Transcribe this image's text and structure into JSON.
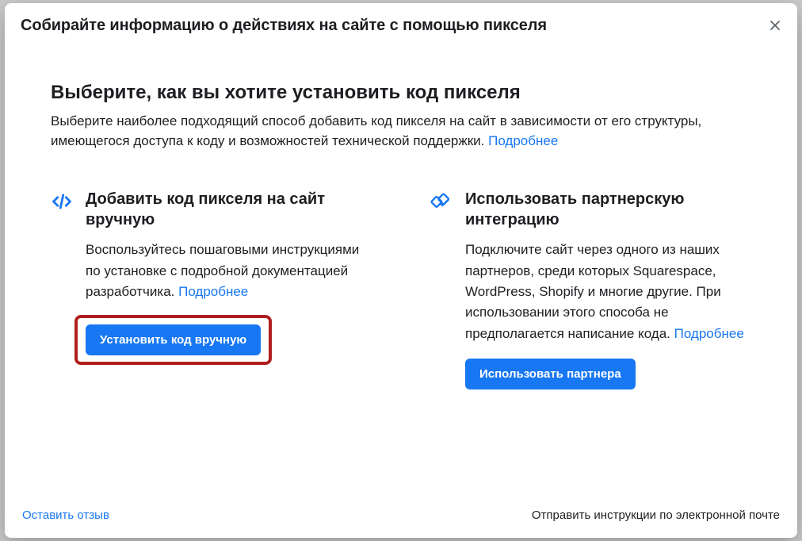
{
  "modal": {
    "title": "Собирайте информацию о действиях на сайте с помощью пикселя",
    "heading": "Выберите, как вы хотите установить код пикселя",
    "subtext": "Выберите наиболее подходящий способ добавить код пикселя на сайт в зависимости от его структуры, имеющегося доступа к коду и возможностей технической поддержки. ",
    "learn_more": "Подробнее"
  },
  "options": {
    "manual": {
      "title": "Добавить код пикселя на сайт вручную",
      "desc": "Воспользуйтесь пошаговыми инструкциями по установке с подробной документацией разработчика. ",
      "learn_more": "Подробнее",
      "button": "Установить код вручную"
    },
    "partner": {
      "title": "Использовать партнерскую интеграцию",
      "desc": "Подключите сайт через одного из наших партнеров, среди которых Squarespace, WordPress, Shopify и многие другие. При использовании этого способа не предполагается написание кода. ",
      "learn_more": "Подробнее",
      "button": "Использовать партнера"
    }
  },
  "footer": {
    "feedback": "Оставить отзыв",
    "send_email": "Отправить инструкции по электронной почте"
  }
}
